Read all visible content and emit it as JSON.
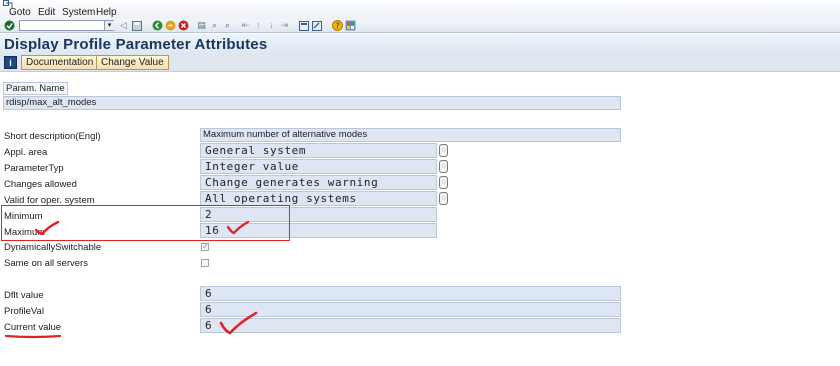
{
  "menubar": {
    "items": [
      "Goto",
      "Edit",
      "System",
      "Help"
    ]
  },
  "toolbar": {
    "command_field": ""
  },
  "title": "Display Profile Parameter Attributes",
  "app_toolbar": {
    "info_label": "i",
    "documentation_label": "Documentation",
    "change_value_label": "Change Value"
  },
  "form": {
    "param_name_label": "Param. Name",
    "param_name_value": "rdisp/max_alt_modes",
    "short_desc_label": "Short description(Engl)",
    "short_desc_value": "Maximum number of alternative modes",
    "appl_area_label": "Appl. area",
    "appl_area_value": "General system",
    "param_type_label": "ParameterTyp",
    "param_type_value": "Integer value",
    "changes_allowed_label": "Changes allowed",
    "changes_allowed_value": "Change generates warning",
    "valid_os_label": "Valid for oper. system",
    "valid_os_value": "All operating systems",
    "minimum_label": "Minimum",
    "minimum_value": "2",
    "maximum_label": "Maximum",
    "maximum_value": "16",
    "dyn_switch_label": "DynamicallySwitchable",
    "dyn_switch_checked": true,
    "same_servers_label": "Same on all servers",
    "same_servers_checked": false,
    "dflt_label": "Dflt value",
    "dflt_value": "6",
    "profile_label": "ProfileVal",
    "profile_value": "6",
    "current_label": "Current value",
    "current_value": "6"
  },
  "colors": {
    "field_bg": "#dde6f2",
    "title": "#17375e",
    "annotation": "#e02424"
  }
}
